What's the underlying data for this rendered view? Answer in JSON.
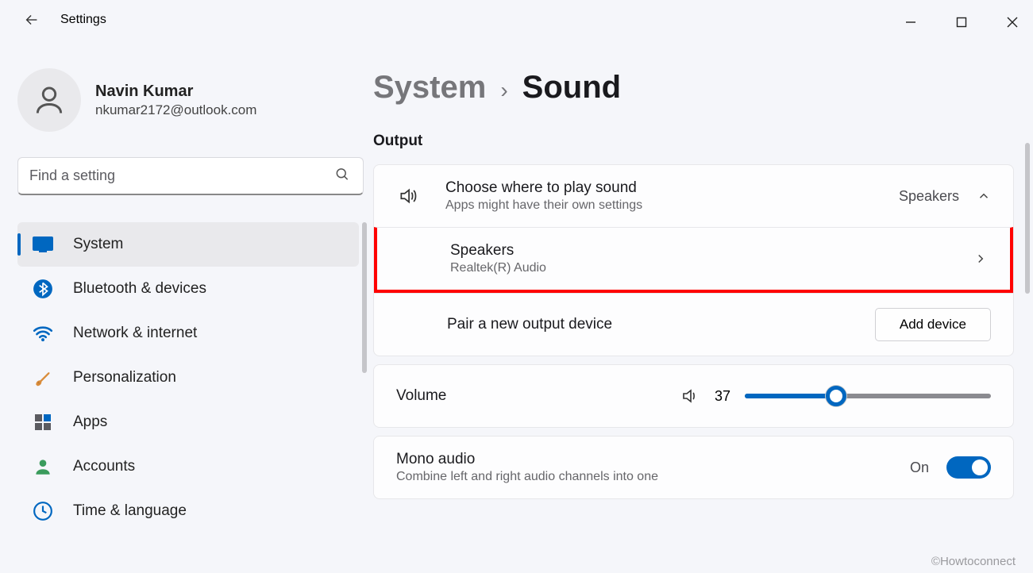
{
  "window": {
    "title": "Settings"
  },
  "profile": {
    "name": "Navin Kumar",
    "email": "nkumar2172@outlook.com"
  },
  "search": {
    "placeholder": "Find a setting"
  },
  "nav": [
    {
      "label": "System",
      "icon": "monitor",
      "active": true
    },
    {
      "label": "Bluetooth & devices",
      "icon": "bluetooth"
    },
    {
      "label": "Network & internet",
      "icon": "wifi"
    },
    {
      "label": "Personalization",
      "icon": "brush"
    },
    {
      "label": "Apps",
      "icon": "apps"
    },
    {
      "label": "Accounts",
      "icon": "person"
    },
    {
      "label": "Time & language",
      "icon": "clock"
    }
  ],
  "breadcrumb": {
    "parent": "System",
    "current": "Sound"
  },
  "output": {
    "heading": "Output",
    "choose": {
      "title": "Choose where to play sound",
      "sub": "Apps might have their own settings",
      "value": "Speakers"
    },
    "speakers": {
      "title": "Speakers",
      "sub": "Realtek(R) Audio"
    },
    "pair": {
      "title": "Pair a new output device",
      "button": "Add device"
    },
    "volume": {
      "title": "Volume",
      "value": "37",
      "percent": 37
    },
    "mono": {
      "title": "Mono audio",
      "sub": "Combine left and right audio channels into one",
      "state": "On"
    }
  },
  "watermark": "©Howtoconnect"
}
